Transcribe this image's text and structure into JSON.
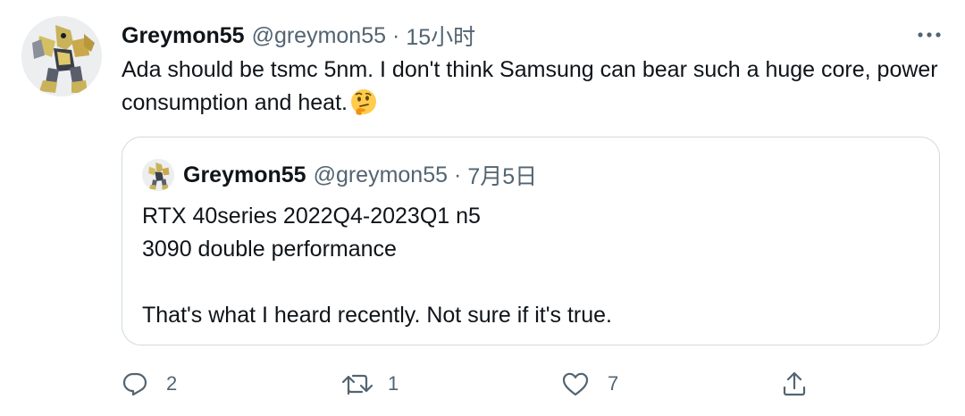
{
  "tweet": {
    "display_name": "Greymon55",
    "handle": "@greymon55",
    "separator": "·",
    "timestamp": "15小时",
    "text": "Ada should be tsmc 5nm. I don't think Samsung can bear such a huge core, power consumption and heat.",
    "emoji": "thinking-face"
  },
  "quote": {
    "display_name": "Greymon55",
    "handle": "@greymon55",
    "separator": "·",
    "timestamp": "7月5日",
    "lines": [
      "RTX 40series 2022Q4-2023Q1 n5",
      "3090 double performance",
      "",
      "That's what I heard recently. Not sure if it's true."
    ]
  },
  "actions": {
    "reply_count": "2",
    "retweet_count": "1",
    "like_count": "7"
  },
  "icons": {
    "more": "more-horizontal-icon",
    "reply": "reply-icon",
    "retweet": "retweet-icon",
    "like": "heart-icon",
    "share": "share-icon"
  },
  "colors": {
    "text": "#0f1419",
    "secondary": "#536471",
    "border": "#cfd9de"
  }
}
